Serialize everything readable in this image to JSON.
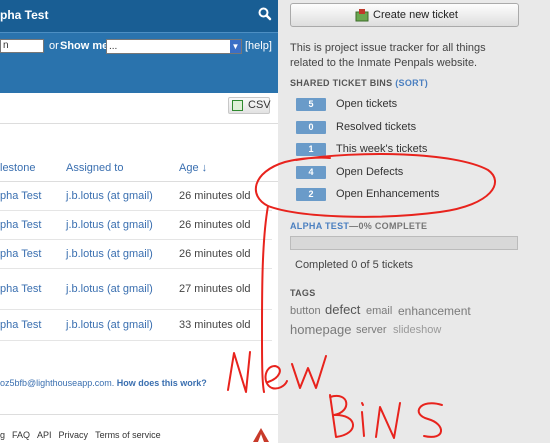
{
  "header": {
    "project_title": "pha Test"
  },
  "filters": {
    "search_value": "n",
    "or_text": "or",
    "showme_label": "Show me:",
    "showme_selected": "...",
    "help_link": "[help]"
  },
  "toolbar": {
    "csv_label": "CSV"
  },
  "table": {
    "columns": {
      "milestone": "lestone",
      "assigned": "Assigned to",
      "age": "Age ↓"
    },
    "rows": [
      {
        "milestone": "pha Test",
        "assigned": "j.b.lotus (at gmail)",
        "age": "26 minutes old"
      },
      {
        "milestone": "pha Test",
        "assigned": "j.b.lotus (at gmail)",
        "age": "26 minutes old"
      },
      {
        "milestone": "pha Test",
        "assigned": "j.b.lotus (at gmail)",
        "age": "26 minutes old"
      },
      {
        "milestone": "pha Test",
        "assigned": "j.b.lotus (at gmail)",
        "age": "27 minutes old"
      },
      {
        "milestone": "pha Test",
        "assigned": "j.b.lotus (at gmail)",
        "age": "33 minutes old"
      }
    ]
  },
  "footnote": {
    "email": "oz5bfb@lighthouseapp.com.",
    "how_link": "How does this work?"
  },
  "footer": {
    "links": [
      "g",
      "FAQ",
      "API",
      "Privacy",
      "Terms of service"
    ]
  },
  "sidebar": {
    "create_button": "Create new ticket",
    "description": "This is project issue tracker for all things related to the Inmate Penpals website.",
    "bins_heading": "SHARED TICKET BINS",
    "bins_sort": "(SORT)",
    "bins": [
      {
        "count": "5",
        "label": "Open tickets"
      },
      {
        "count": "0",
        "label": "Resolved tickets"
      },
      {
        "count": "1",
        "label": "This week's tickets"
      },
      {
        "count": "4",
        "label": "Open Defects"
      },
      {
        "count": "2",
        "label": "Open Enhancements"
      }
    ],
    "milestone": {
      "name": "ALPHA TEST",
      "pct_text": "—0% COMPLETE",
      "progress": 0,
      "status": "Completed 0 of 5 tickets"
    },
    "tags_heading": "TAGS",
    "tags": [
      "button",
      "defect",
      "email",
      "enhancement",
      "homepage",
      "server",
      "slideshow"
    ]
  },
  "annotation": {
    "line1": "New",
    "line2": "BiNS"
  },
  "colors": {
    "header_blue": "#195e94",
    "bin_blue": "#6a9bc9",
    "annotation_red": "#e8231d"
  }
}
